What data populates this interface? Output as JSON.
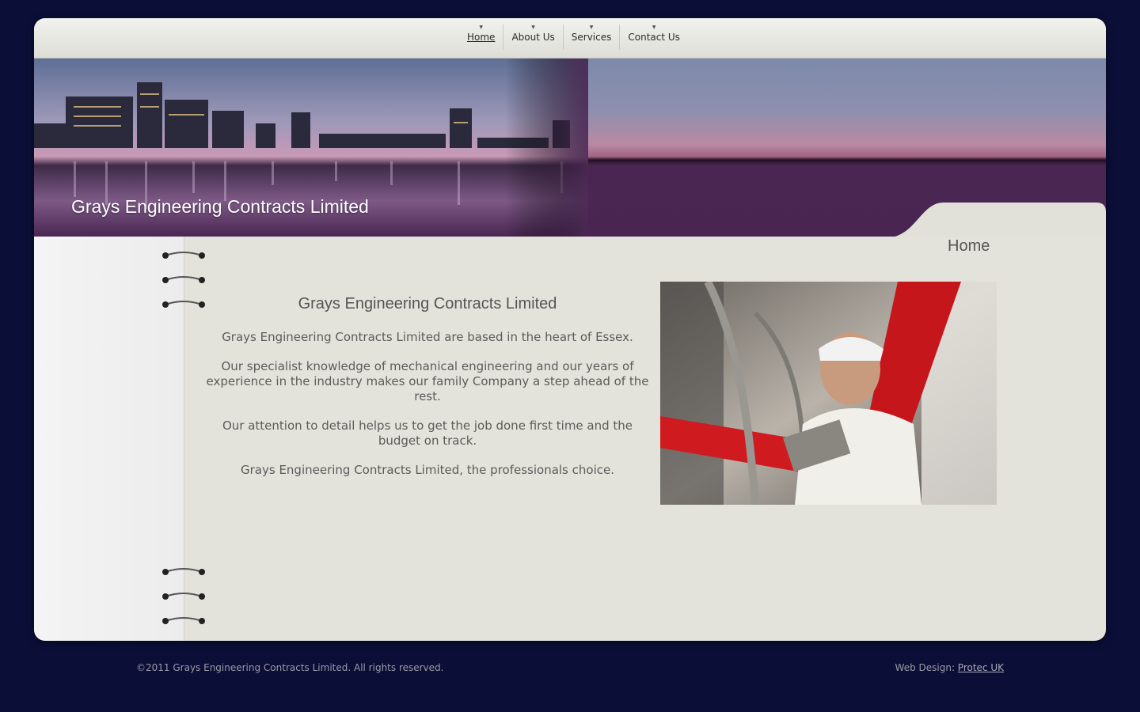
{
  "nav": {
    "items": [
      {
        "label": "Home",
        "active": true
      },
      {
        "label": "About Us",
        "active": false
      },
      {
        "label": "Services",
        "active": false
      },
      {
        "label": "Contact Us",
        "active": false
      }
    ]
  },
  "header": {
    "site_title": "Grays Engineering Contracts Limited",
    "page_heading": "Home"
  },
  "main": {
    "heading": "Grays Engineering Contracts Limited",
    "paragraphs": [
      "Grays Engineering Contracts Limited are based in the heart of Essex.",
      "Our specialist knowledge of mechanical engineering and our years of experience in the industry makes our family Company a step ahead of the rest.",
      "Our attention to detail helps us to get the job done first time and the budget on track.",
      "Grays Engineering Contracts Limited, the professionals choice."
    ]
  },
  "footer": {
    "copyright": "©2011 Grays Engineering Contracts Limited. All rights reserved.",
    "design_prefix": "Web Design: ",
    "design_link": "Protec  UK"
  },
  "colors": {
    "page_background": "#0b0f38",
    "panel": "#e3e3dc",
    "banner_purple": "#492652",
    "accent_red": "#d0161c"
  },
  "icons": [
    "caret-down-icon",
    "notebook-ring-icon"
  ]
}
